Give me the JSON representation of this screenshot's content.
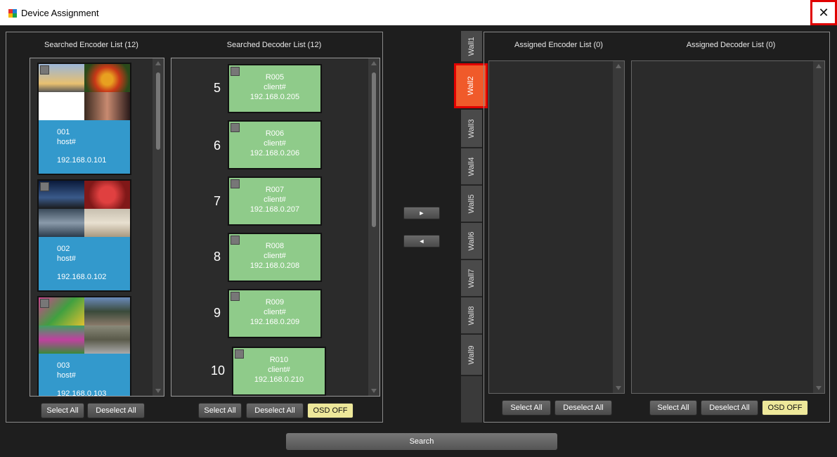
{
  "window": {
    "title": "Device Assignment",
    "close_glyph": "✕"
  },
  "encoder_list": {
    "title": "Searched Encoder List (12)",
    "items": [
      {
        "id": "001",
        "host": "host#",
        "ip": "192.168.0.101"
      },
      {
        "id": "002",
        "host": "host#",
        "ip": "192.168.0.102"
      },
      {
        "id": "003",
        "host": "host#",
        "ip": "192.168.0.103"
      }
    ],
    "select_all": "Select All",
    "deselect_all": "Deselect All"
  },
  "decoder_list": {
    "title": "Searched Decoder List (12)",
    "items": [
      {
        "num": "5",
        "name": "R005",
        "client": "client#",
        "ip": "192.168.0.205"
      },
      {
        "num": "6",
        "name": "R006",
        "client": "client#",
        "ip": "192.168.0.206"
      },
      {
        "num": "7",
        "name": "R007",
        "client": "client#",
        "ip": "192.168.0.207"
      },
      {
        "num": "8",
        "name": "R008",
        "client": "client#",
        "ip": "192.168.0.208"
      },
      {
        "num": "9",
        "name": "R009",
        "client": "client#",
        "ip": "192.168.0.209"
      },
      {
        "num": "10",
        "name": "R010",
        "client": "client#",
        "ip": "192.168.0.210"
      }
    ],
    "select_all": "Select All",
    "deselect_all": "Deselect All",
    "osd": "OSD OFF"
  },
  "transfer": {
    "right_glyph": "►",
    "left_glyph": "◄"
  },
  "walls": [
    "Wall1",
    "Wall2",
    "Wall3",
    "Wall4",
    "Wall5",
    "Wall6",
    "Wall7",
    "Wall8",
    "Wall9"
  ],
  "active_wall": "Wall2",
  "assigned_encoder": {
    "title": "Assigned Encoder List (0)",
    "select_all": "Select All",
    "deselect_all": "Deselect All"
  },
  "assigned_decoder": {
    "title": "Assigned Decoder List (0)",
    "select_all": "Select All",
    "deselect_all": "Deselect All",
    "osd": "OSD OFF"
  },
  "search": {
    "label": "Search"
  },
  "colors": {
    "encoder_info": "#3399cc",
    "decoder_card": "#8fcb8a",
    "active_wall": "#f05a2a",
    "highlight": "#e00000",
    "osd_button": "#eee89a"
  }
}
